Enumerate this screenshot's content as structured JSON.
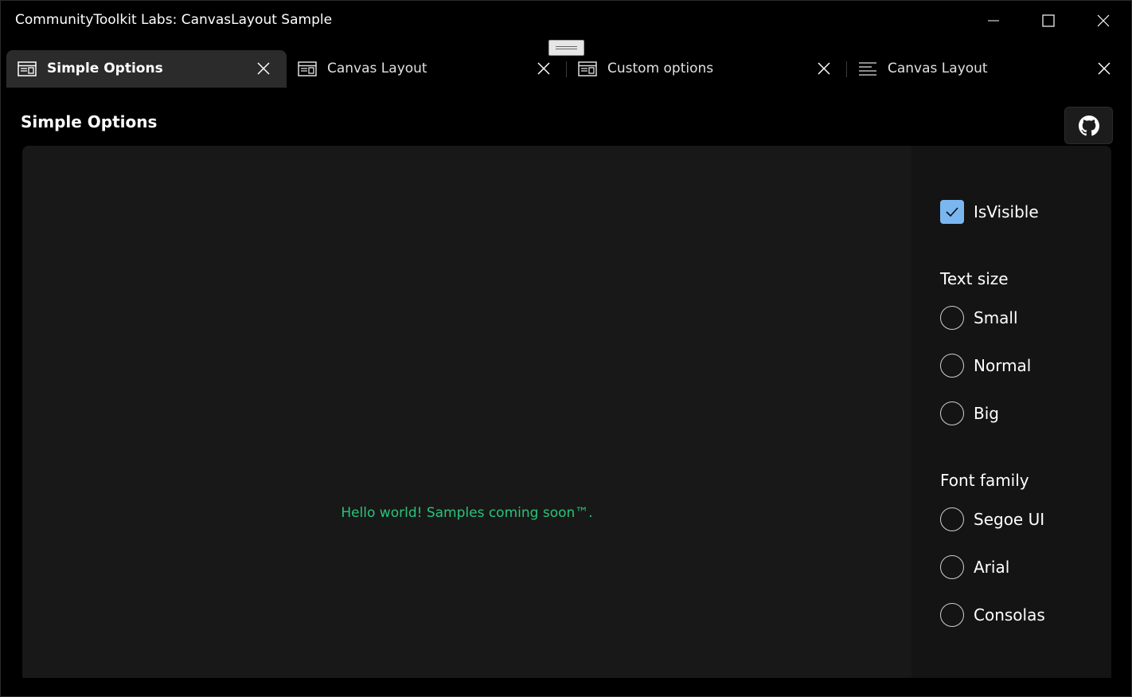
{
  "window": {
    "title": "CommunityToolkit Labs: CanvasLayout Sample",
    "controls": {
      "minimize": "minimize",
      "maximize": "maximize",
      "close": "close"
    }
  },
  "tabs": [
    {
      "label": "Simple Options",
      "active": true,
      "icon": "sample-page-icon"
    },
    {
      "label": "Canvas Layout",
      "active": false,
      "icon": "sample-page-icon"
    },
    {
      "label": "Custom options",
      "active": false,
      "icon": "sample-page-icon"
    },
    {
      "label": "Canvas Layout",
      "active": false,
      "icon": "document-lines-icon"
    }
  ],
  "page": {
    "title": "Simple Options",
    "github_icon": "github-icon"
  },
  "sample": {
    "message": "Hello world! Samples coming soon™."
  },
  "options": {
    "is_visible": {
      "label": "IsVisible",
      "checked": true
    },
    "text_size": {
      "header": "Text size",
      "options": [
        "Small",
        "Normal",
        "Big"
      ]
    },
    "font_family": {
      "header": "Font family",
      "options": [
        "Segoe UI",
        "Arial",
        "Consolas"
      ]
    }
  },
  "colors": {
    "accent": "#7ab7f0",
    "message": "#29c47a",
    "active_tab": "#2b2b2b"
  }
}
